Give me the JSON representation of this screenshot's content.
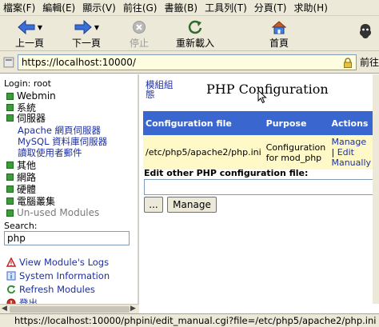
{
  "menubar": {
    "items": [
      "檔案(F)",
      "編輯(E)",
      "顯示(V)",
      "前往(G)",
      "書籤(B)",
      "工具列(T)",
      "分頁(T)",
      "求助(H)"
    ]
  },
  "toolbar": {
    "back_label": "上一頁",
    "forward_label": "下一頁",
    "stop_label": "停止",
    "reload_label": "重新載入",
    "home_label": "首頁"
  },
  "location": {
    "url": "https://localhost:10000/",
    "go_label": "前往"
  },
  "sidebar": {
    "login": "Login: root",
    "categories": [
      "Webmin",
      "系統",
      "伺服器"
    ],
    "server_modules": [
      "Apache 網頁伺服器",
      "MySQL 資料庫伺服器",
      "讀取使用者郵件"
    ],
    "more_categories": [
      "其他",
      "網路",
      "硬體",
      "電腦叢集"
    ],
    "unused": "Un-used Modules",
    "search_label": "Search:",
    "search_value": "php",
    "links": [
      "View Module's Logs",
      "System Information",
      "Refresh Modules",
      "登出"
    ]
  },
  "main": {
    "module_index": [
      "模組組",
      "態"
    ],
    "title": "PHP Configuration",
    "table": {
      "headers": [
        "Configuration file",
        "Purpose",
        "Actions"
      ],
      "row": {
        "file": "/etc/php5/apache2/php.ini",
        "purpose": "Configuration for mod_php",
        "manage": "Manage",
        "separator": "|",
        "edit": "Edit Manually"
      }
    },
    "edit_other_label": "Edit other PHP configuration file:",
    "browse_button": "...",
    "manage_button": "Manage"
  },
  "statusbar": {
    "text": "https://localhost:10000/phpini/edit_manual.cgi?file=/etc/php5/apache2/php.ini"
  },
  "colors": {
    "chrome": "#ece9d8",
    "table_header": "#3a67cf",
    "table_row": "#fff9c8",
    "link": "#1d2fa0",
    "module_box": "#3c9c3c"
  }
}
